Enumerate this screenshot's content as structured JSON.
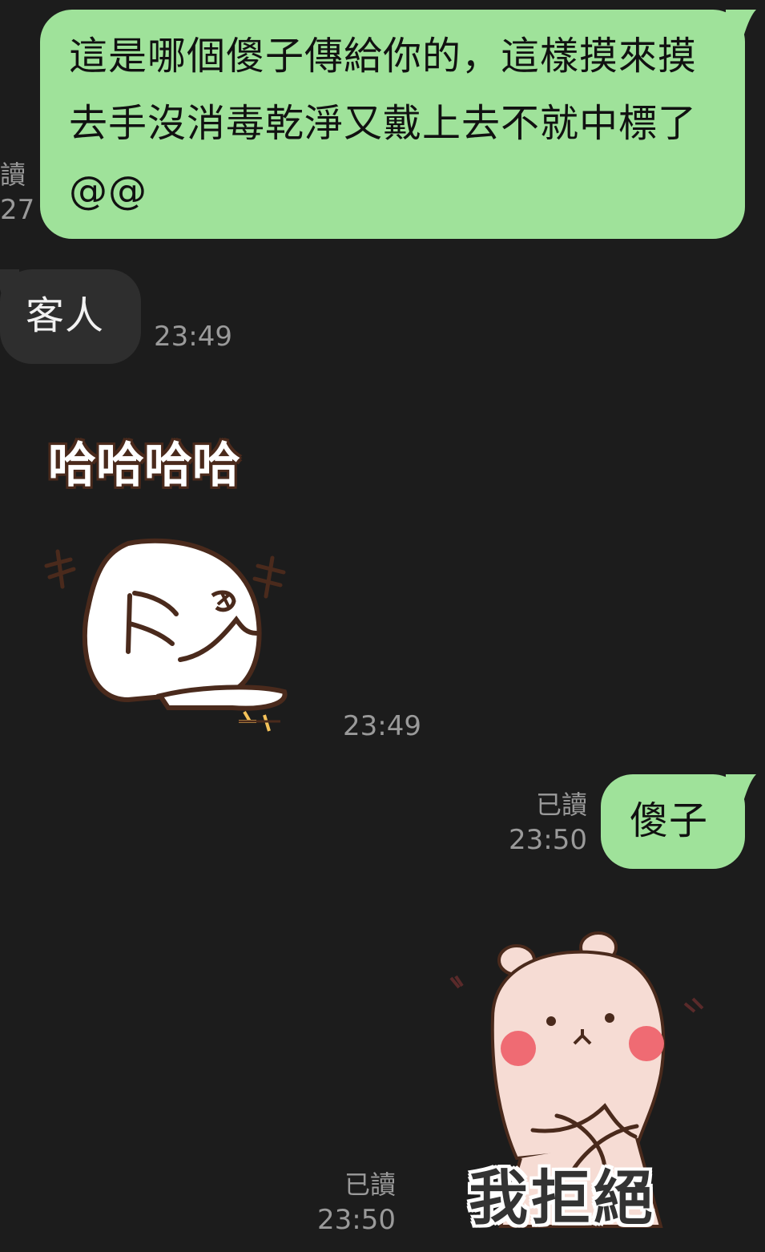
{
  "messages": {
    "m1": {
      "text": "這是哪個傻子傳給你的，這樣摸來摸去手沒消毒乾淨又戴上去不就中標了@@",
      "read_label_partial": "讀",
      "time_partial": "27"
    },
    "m2": {
      "text": "客人",
      "time": "23:49"
    },
    "m3": {
      "sticker_text": "哈哈哈哈",
      "sticker_marks": "キ",
      "time": "23:49"
    },
    "m4": {
      "text": "傻子",
      "read_label": "已讀",
      "time": "23:50"
    },
    "m5": {
      "sticker_text": "我拒絕",
      "read_label": "已讀",
      "time": "23:50"
    }
  },
  "colors": {
    "background": "#1c1c1c",
    "outgoing_bubble": "#9fe29a",
    "incoming_bubble": "#2e2e2e",
    "meta_text": "#9a9a9a"
  }
}
